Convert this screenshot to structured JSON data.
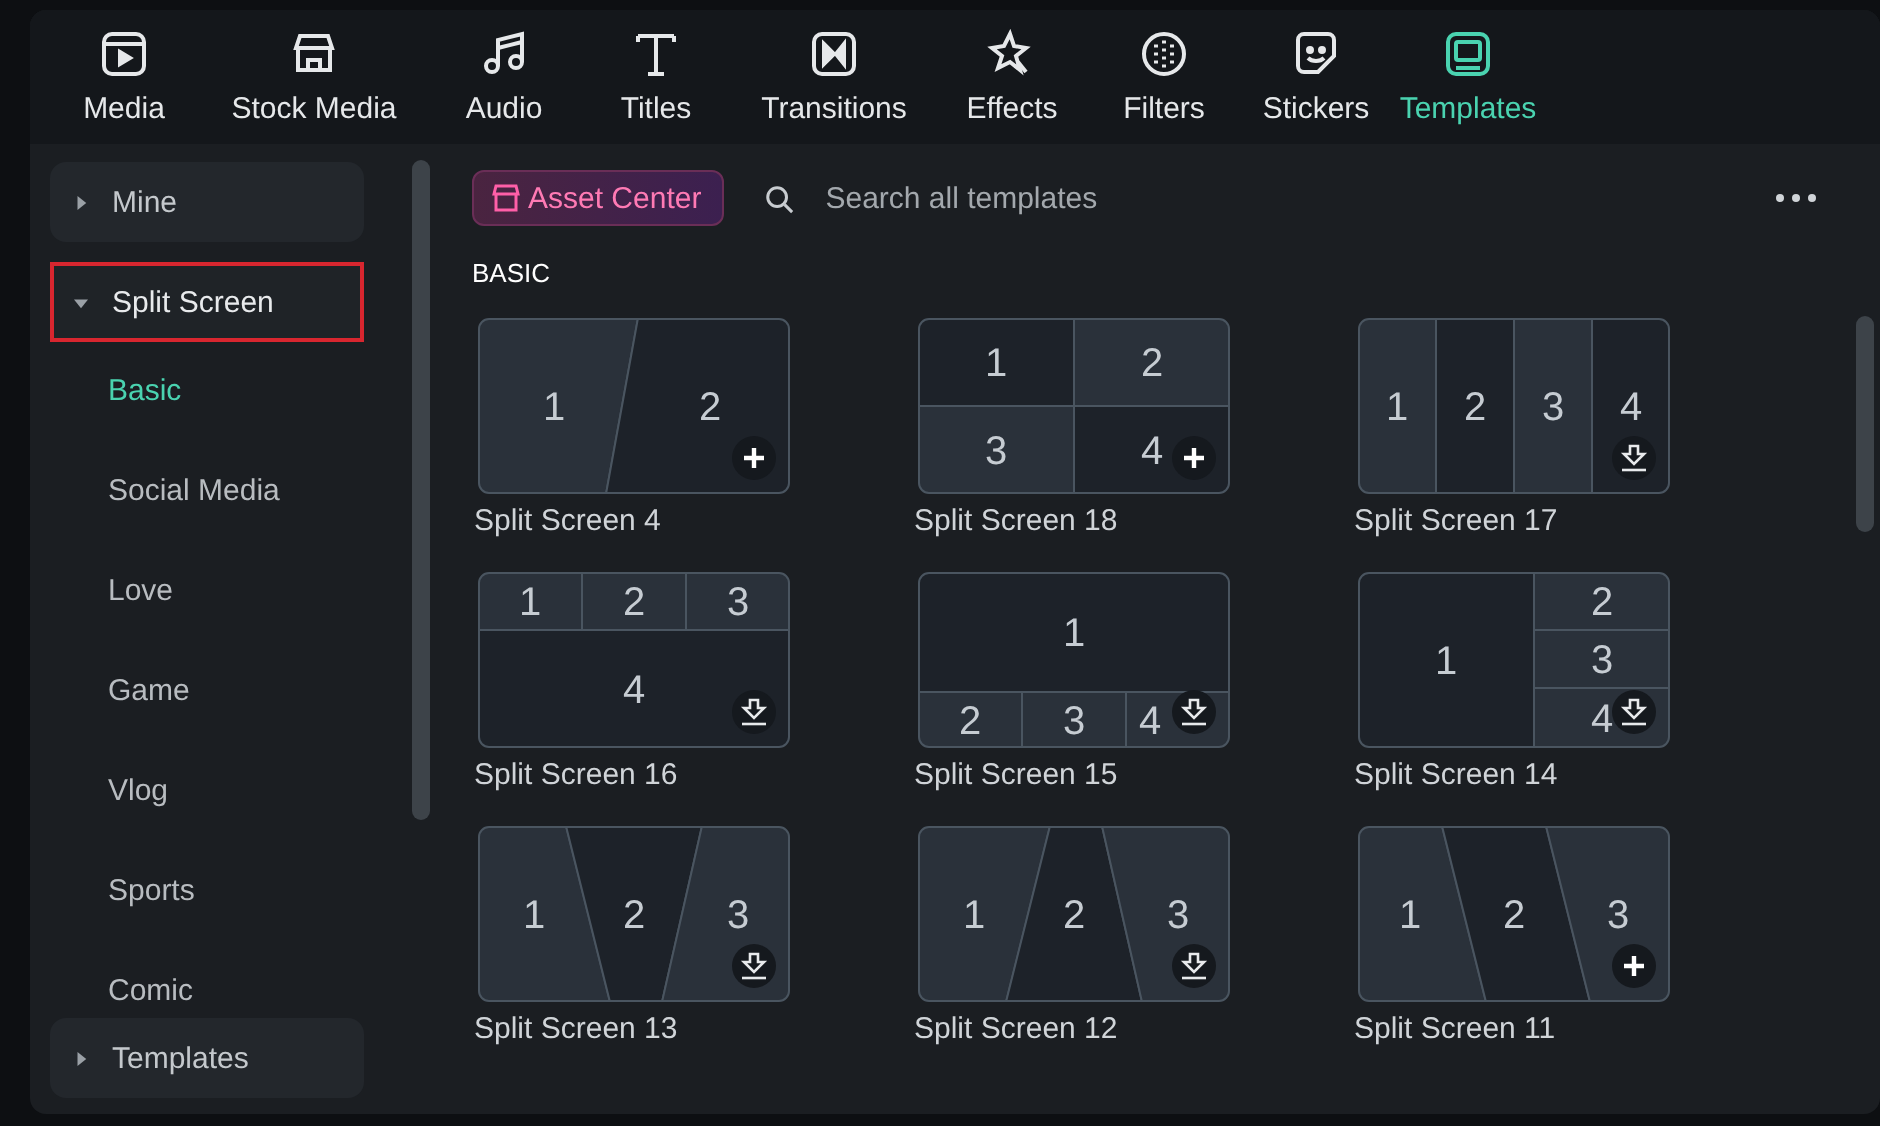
{
  "toolbar": [
    {
      "label": "Media",
      "selected": false
    },
    {
      "label": "Stock Media",
      "selected": false
    },
    {
      "label": "Audio",
      "selected": false
    },
    {
      "label": "Titles",
      "selected": false
    },
    {
      "label": "Transitions",
      "selected": false
    },
    {
      "label": "Effects",
      "selected": false
    },
    {
      "label": "Filters",
      "selected": false
    },
    {
      "label": "Stickers",
      "selected": false
    },
    {
      "label": "Templates",
      "selected": true
    }
  ],
  "sidebar": {
    "groups": [
      {
        "label": "Mine",
        "expanded": false,
        "highlighted": false
      },
      {
        "label": "Split Screen",
        "expanded": true,
        "highlighted": true,
        "children": [
          {
            "label": "Basic",
            "selected": true
          },
          {
            "label": "Social Media",
            "selected": false
          },
          {
            "label": "Love",
            "selected": false
          },
          {
            "label": "Game",
            "selected": false
          },
          {
            "label": "Vlog",
            "selected": false
          },
          {
            "label": "Sports",
            "selected": false
          },
          {
            "label": "Comic",
            "selected": false
          }
        ]
      }
    ],
    "footer_group": {
      "label": "Templates",
      "expanded": false
    }
  },
  "asset_center": "Asset Center",
  "search": {
    "placeholder": "Search all templates"
  },
  "section_title": "BASIC",
  "templates": [
    {
      "name": "Split Screen 4",
      "kind": "diagonal",
      "panes": [
        "1",
        "2"
      ],
      "downloaded": true
    },
    {
      "name": "Split Screen 18",
      "kind": "grid",
      "panes": [
        "1",
        "2",
        "3",
        "4"
      ],
      "downloaded": true
    },
    {
      "name": "Split Screen 17",
      "kind": "columns",
      "panes": [
        "1",
        "2",
        "3",
        "4"
      ],
      "downloaded": false
    },
    {
      "name": "Split Screen 16",
      "kind": "top-three",
      "panes": [
        "1",
        "2",
        "3",
        "4"
      ],
      "downloaded": false
    },
    {
      "name": "Split Screen 15",
      "kind": "bottom-three",
      "panes": [
        "1",
        "2",
        "3",
        "4"
      ],
      "downloaded": false
    },
    {
      "name": "Split Screen 14",
      "kind": "right-three",
      "panes": [
        "1",
        "2",
        "3",
        "4"
      ],
      "downloaded": false
    },
    {
      "name": "Split Screen 13",
      "kind": "wedge-down",
      "panes": [
        "1",
        "2",
        "3"
      ],
      "downloaded": false
    },
    {
      "name": "Split Screen 12",
      "kind": "wedge-up",
      "panes": [
        "1",
        "2",
        "3"
      ],
      "downloaded": false
    },
    {
      "name": "Split Screen 11",
      "kind": "slant",
      "panes": [
        "1",
        "2",
        "3"
      ],
      "downloaded": true
    }
  ]
}
